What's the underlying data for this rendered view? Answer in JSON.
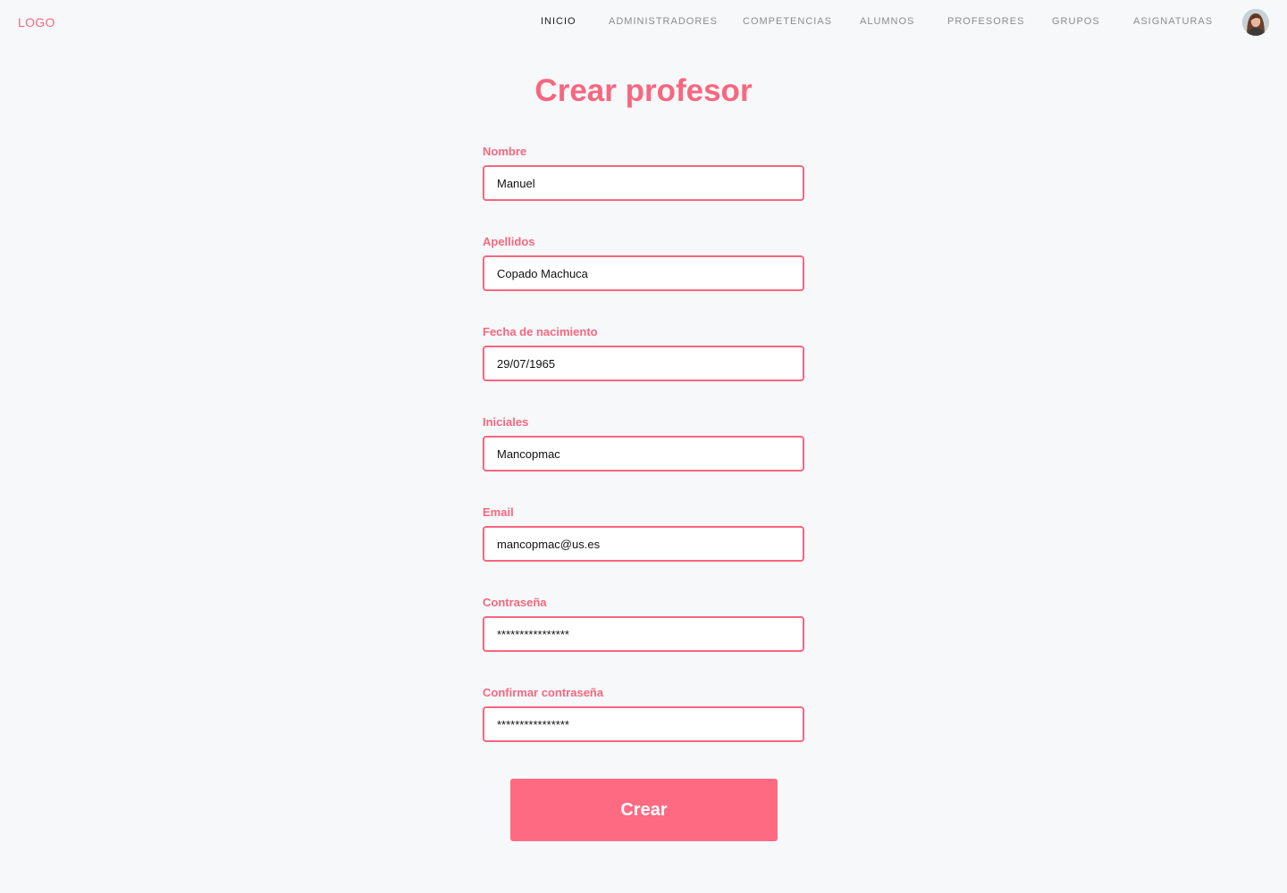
{
  "navbar": {
    "logo": "LOGO",
    "links": [
      {
        "label": "INICIO"
      },
      {
        "label": "ADMINISTRADORES"
      },
      {
        "label": "COMPETENCIAS"
      },
      {
        "label": "ALUMNOS"
      },
      {
        "label": "PROFESORES"
      },
      {
        "label": "GRUPOS"
      },
      {
        "label": "ASIGNATURAS"
      }
    ],
    "active_link": "INICIO",
    "avatar_icon": "user-avatar-photo"
  },
  "form": {
    "title": "Crear profesor",
    "fields": [
      {
        "label": "Nombre",
        "value": "Manuel"
      },
      {
        "label": "Apellidos",
        "value": "Copado Machuca"
      },
      {
        "label": "Fecha de nacimiento",
        "value": "29/07/1965"
      },
      {
        "label": "Iniciales",
        "value": "Mancopmac"
      },
      {
        "label": "Email",
        "value": "mancopmac@us.es"
      },
      {
        "label": "Contraseña",
        "value": "****************"
      },
      {
        "label": "Confirmar contraseña",
        "value": "****************"
      }
    ],
    "submit_label": "Crear"
  },
  "colors": {
    "accent": "#f7677f",
    "button": "#fd6a82",
    "background": "#f6f8fa",
    "nav_text": "#8c8c8c",
    "nav_active": "#1f1f1f"
  }
}
